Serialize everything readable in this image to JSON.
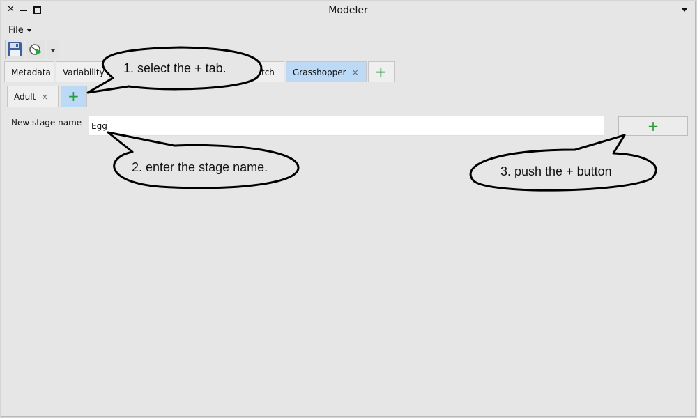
{
  "window": {
    "title": "Modeler"
  },
  "menu": {
    "file": "File"
  },
  "tabs_main": [
    {
      "label": "Metadata"
    },
    {
      "label": "Variability"
    },
    {
      "label": "tch"
    },
    {
      "label": "Grasshopper",
      "close": "×"
    },
    {
      "label": "+"
    }
  ],
  "tabs_stage": [
    {
      "label": "Adult",
      "close": "×"
    },
    {
      "label": "+"
    }
  ],
  "form": {
    "label": "New stage name",
    "value": "Egg",
    "add_label": "+"
  },
  "callouts": [
    {
      "text": "1. select the + tab."
    },
    {
      "text": "2. enter the stage name."
    },
    {
      "text": "3. push the + button"
    }
  ],
  "colors": {
    "selected_tab": "#bcd9f6",
    "plus_green": "#2a9a3a"
  }
}
